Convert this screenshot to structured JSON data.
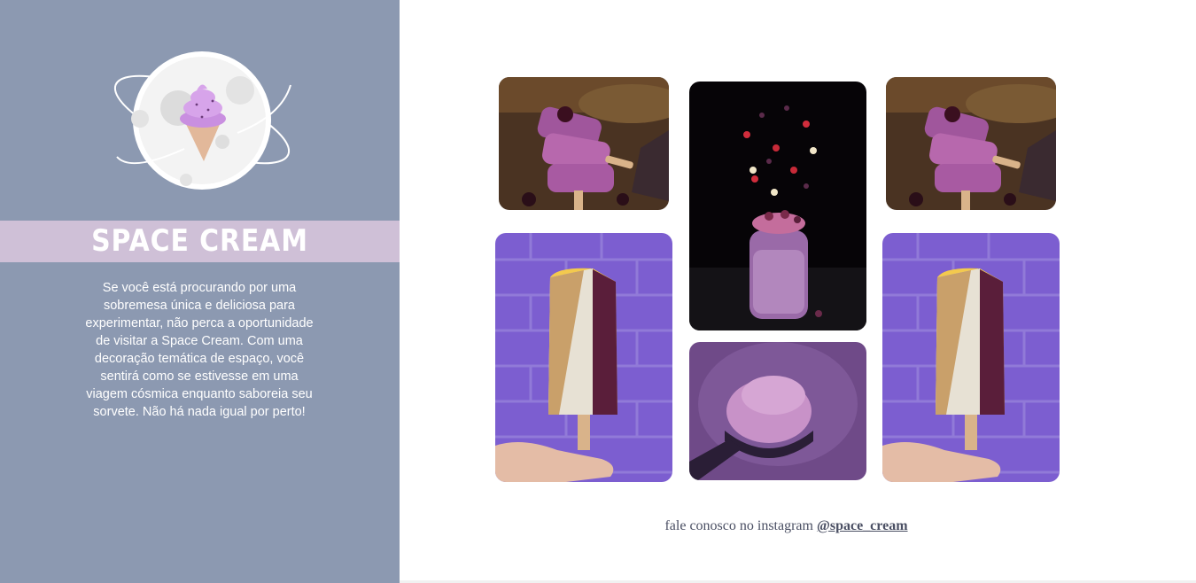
{
  "brand": {
    "title": "SPACE CREAM"
  },
  "sidebar": {
    "description": "Se você está procurando por uma sobremesa única e deliciosa para experimentar, não perca a oportunidade de visitar a Space Cream. Com uma decoração temática de espaço, você sentirá como se estivesse em uma viagem cósmica enquanto saboreia seu sorvete. Não há nada igual por perto!"
  },
  "gallery": {
    "photos": [
      {
        "subject": "purple popsicles with blackberries"
      },
      {
        "subject": "berry smoothie jar with falling fruit"
      },
      {
        "subject": "purple popsicles with blackberries"
      },
      {
        "subject": "nut-covered popsicle against purple brick wall"
      },
      {
        "subject": "scoop of purple ice cream"
      },
      {
        "subject": "nut-covered popsicle against purple brick wall"
      }
    ]
  },
  "footer": {
    "text": "fale conosco no instagram",
    "handle": "@space_cream"
  },
  "colors": {
    "sidebar": "#8c99b1",
    "banner": "#cfc0d7",
    "text_dark": "#4a4f63"
  }
}
